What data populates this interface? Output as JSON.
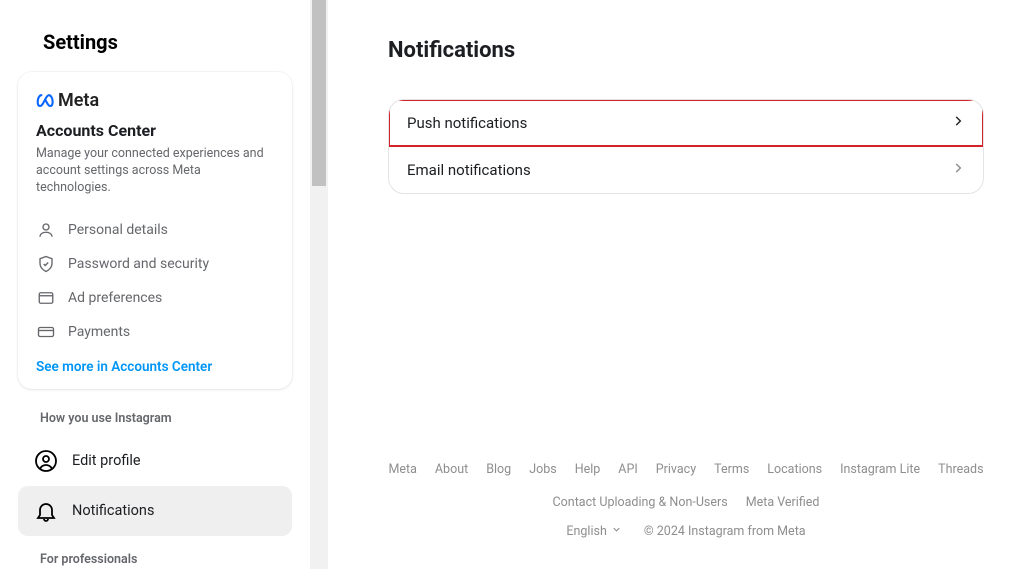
{
  "sidebar": {
    "title": "Settings",
    "meta_brand": "Meta",
    "accounts_center": {
      "heading": "Accounts Center",
      "description": "Manage your connected experiences and account settings across Meta technologies.",
      "items": [
        {
          "label": "Personal details"
        },
        {
          "label": "Password and security"
        },
        {
          "label": "Ad preferences"
        },
        {
          "label": "Payments"
        }
      ],
      "see_more": "See more in Accounts Center"
    },
    "sections": [
      {
        "label": "How you use Instagram",
        "items": [
          {
            "label": "Edit profile",
            "selected": false
          },
          {
            "label": "Notifications",
            "selected": true
          }
        ]
      },
      {
        "label": "For professionals",
        "items": []
      }
    ]
  },
  "main": {
    "title": "Notifications",
    "options": [
      {
        "label": "Push notifications",
        "highlight": true
      },
      {
        "label": "Email notifications",
        "highlight": false
      }
    ]
  },
  "footer": {
    "links": [
      "Meta",
      "About",
      "Blog",
      "Jobs",
      "Help",
      "API",
      "Privacy",
      "Terms",
      "Locations",
      "Instagram Lite",
      "Threads",
      "Contact Uploading & Non-Users",
      "Meta Verified"
    ],
    "language": "English",
    "copyright": "© 2024 Instagram from Meta"
  }
}
